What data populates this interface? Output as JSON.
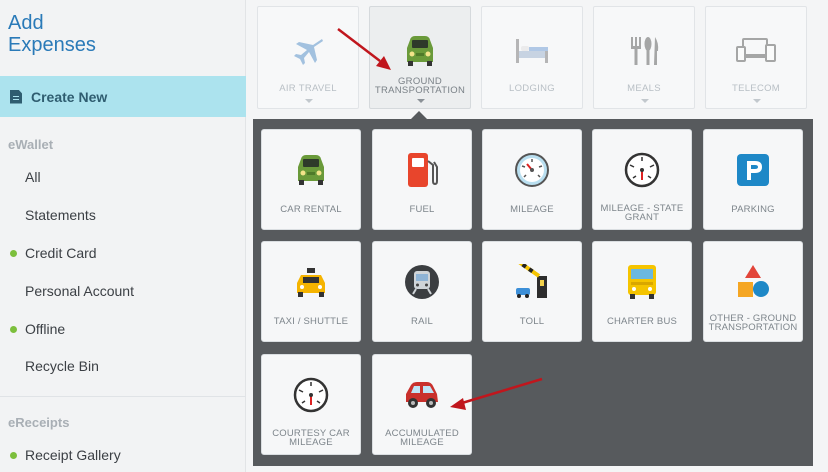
{
  "sidebar": {
    "title_line1": "Add",
    "title_line2": "Expenses",
    "create_new": "Create New",
    "ewallet_label": "eWallet",
    "ewallet_items": [
      {
        "label": "All",
        "dot": false
      },
      {
        "label": "Statements",
        "dot": false
      },
      {
        "label": "Credit Card",
        "dot": true
      },
      {
        "label": "Personal Account",
        "dot": false
      },
      {
        "label": "Offline",
        "dot": true
      },
      {
        "label": "Recycle Bin",
        "dot": false
      }
    ],
    "ereceipts_label": "eReceipts",
    "ereceipt_items": [
      {
        "label": "Receipt Gallery",
        "dot": true
      }
    ]
  },
  "categories": [
    {
      "label_1": "AIR TRAVEL",
      "label_2": "",
      "icon": "airplane-icon",
      "selected": false
    },
    {
      "label_1": "GROUND",
      "label_2": "TRANSPORTATION",
      "icon": "car-icon",
      "selected": true
    },
    {
      "label_1": "LODGING",
      "label_2": "",
      "icon": "bed-icon",
      "selected": false
    },
    {
      "label_1": "MEALS",
      "label_2": "",
      "icon": "utensils-icon",
      "selected": false
    },
    {
      "label_1": "TELECOM",
      "label_2": "",
      "icon": "devices-icon",
      "selected": false
    }
  ],
  "subcategories": [
    {
      "label_1": "CAR RENTAL",
      "label_2": "",
      "icon": "green-car-icon"
    },
    {
      "label_1": "FUEL",
      "label_2": "",
      "icon": "fuel-pump-icon"
    },
    {
      "label_1": "MILEAGE",
      "label_2": "",
      "icon": "speedometer-icon"
    },
    {
      "label_1": "MILEAGE - STATE",
      "label_2": "GRANT",
      "icon": "speedometer-icon"
    },
    {
      "label_1": "PARKING",
      "label_2": "",
      "icon": "parking-icon"
    },
    {
      "label_1": "TAXI / SHUTTLE",
      "label_2": "",
      "icon": "taxi-icon"
    },
    {
      "label_1": "RAIL",
      "label_2": "",
      "icon": "train-icon"
    },
    {
      "label_1": "TOLL",
      "label_2": "",
      "icon": "toll-gate-icon"
    },
    {
      "label_1": "CHARTER BUS",
      "label_2": "",
      "icon": "bus-icon"
    },
    {
      "label_1": "OTHER - GROUND",
      "label_2": "TRANSPORTATION",
      "icon": "shapes-icon"
    },
    {
      "label_1": "COURTESY CAR",
      "label_2": "MILEAGE",
      "icon": "speedometer-icon"
    },
    {
      "label_1": "ACCUMULATED",
      "label_2": "MILEAGE",
      "icon": "red-car-icon"
    }
  ],
  "colors": {
    "accent_blue": "#2a7ab8",
    "create_new_bg": "#ace3ee",
    "panel_bg": "#575a5d",
    "status_dot": "#7cbf3c",
    "annotation_arrow": "#c0161d"
  }
}
